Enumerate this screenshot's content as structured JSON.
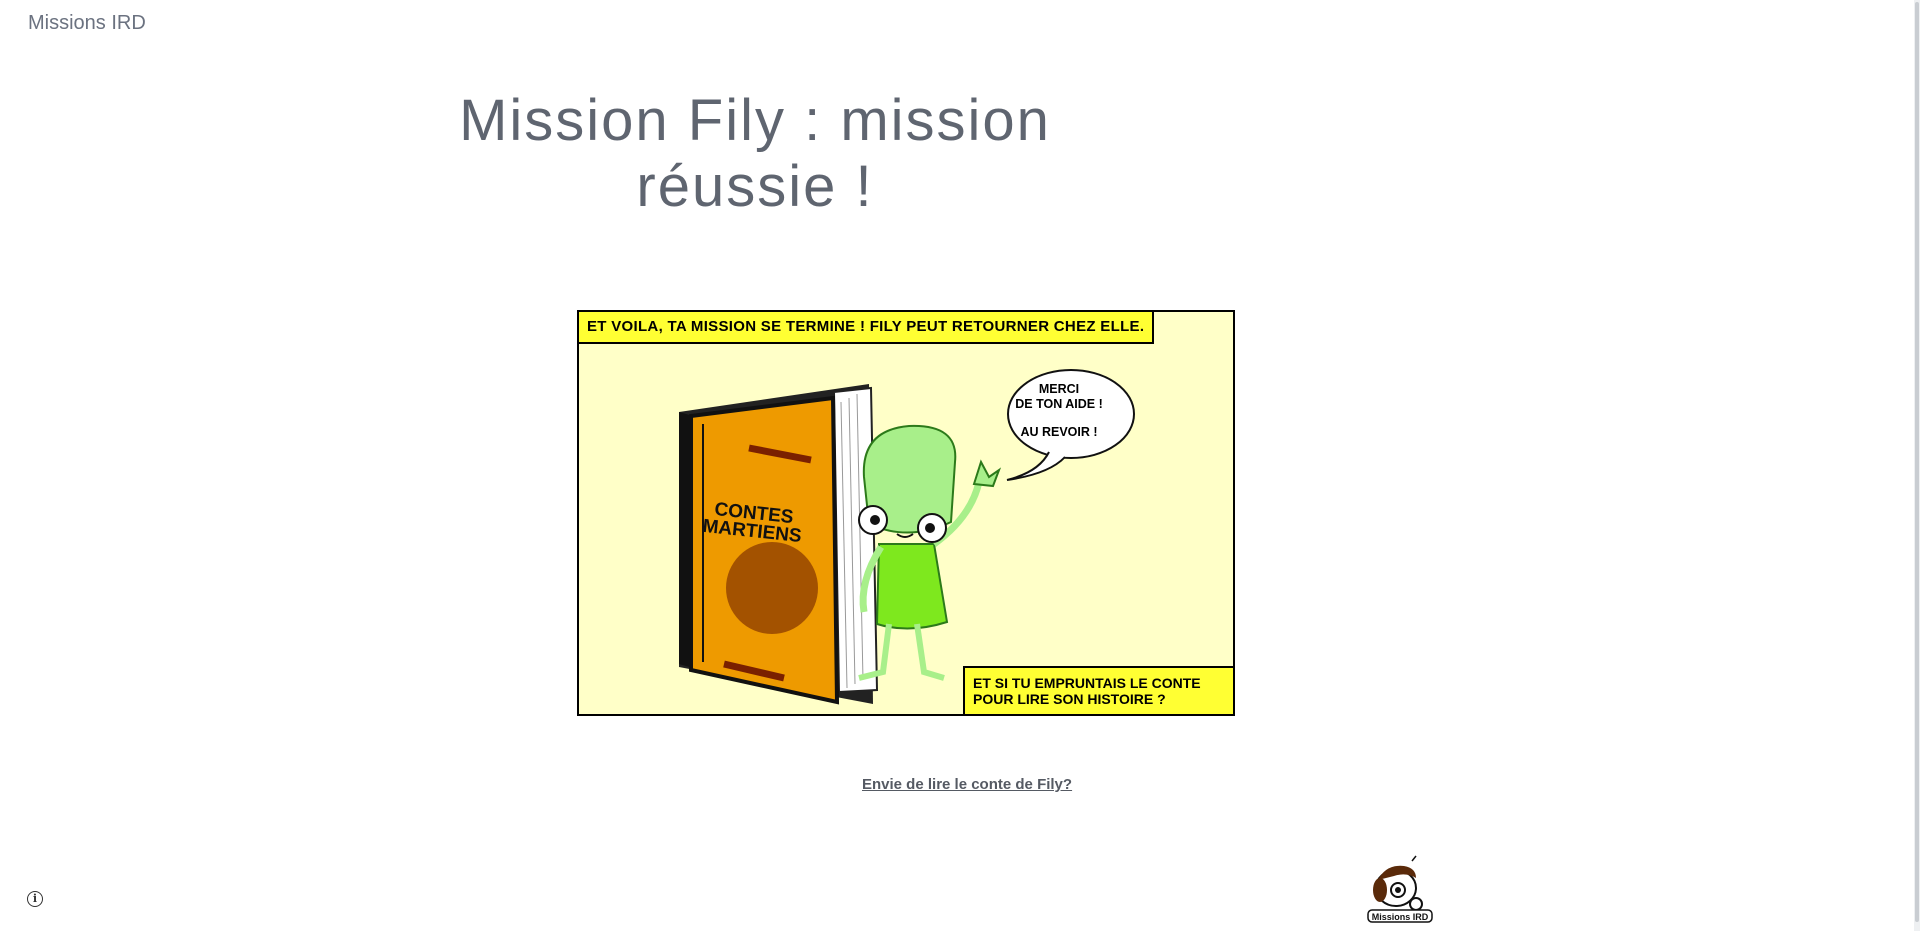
{
  "site": {
    "name": "Missions IRD"
  },
  "page": {
    "title": "Mission Fily : mission réussie !"
  },
  "comic": {
    "caption_top": "ET VOILA, TA MISSION SE TERMINE ! FILY PEUT RETOURNER CHEZ ELLE.",
    "caption_bottom": [
      "ET SI TU EMPRUNTAIS LE CONTE",
      "POUR LIRE SON HISTOIRE ?"
    ],
    "speech_bubble": [
      "MERCI",
      "DE TON AIDE !",
      "AU REVOIR !"
    ],
    "book_title": [
      "CONTES",
      "MARTIENS"
    ]
  },
  "link": {
    "label": "Envie de lire le conte de Fily?"
  },
  "footer": {
    "logo_text": "Missions IRD",
    "info_icon": "info-icon"
  },
  "colors": {
    "panel_bg": "#ffffc8",
    "caption_bg": "#ffff33",
    "book": "#ee9a00",
    "alien": "#a8ef8a",
    "dress": "#7ee81e"
  }
}
